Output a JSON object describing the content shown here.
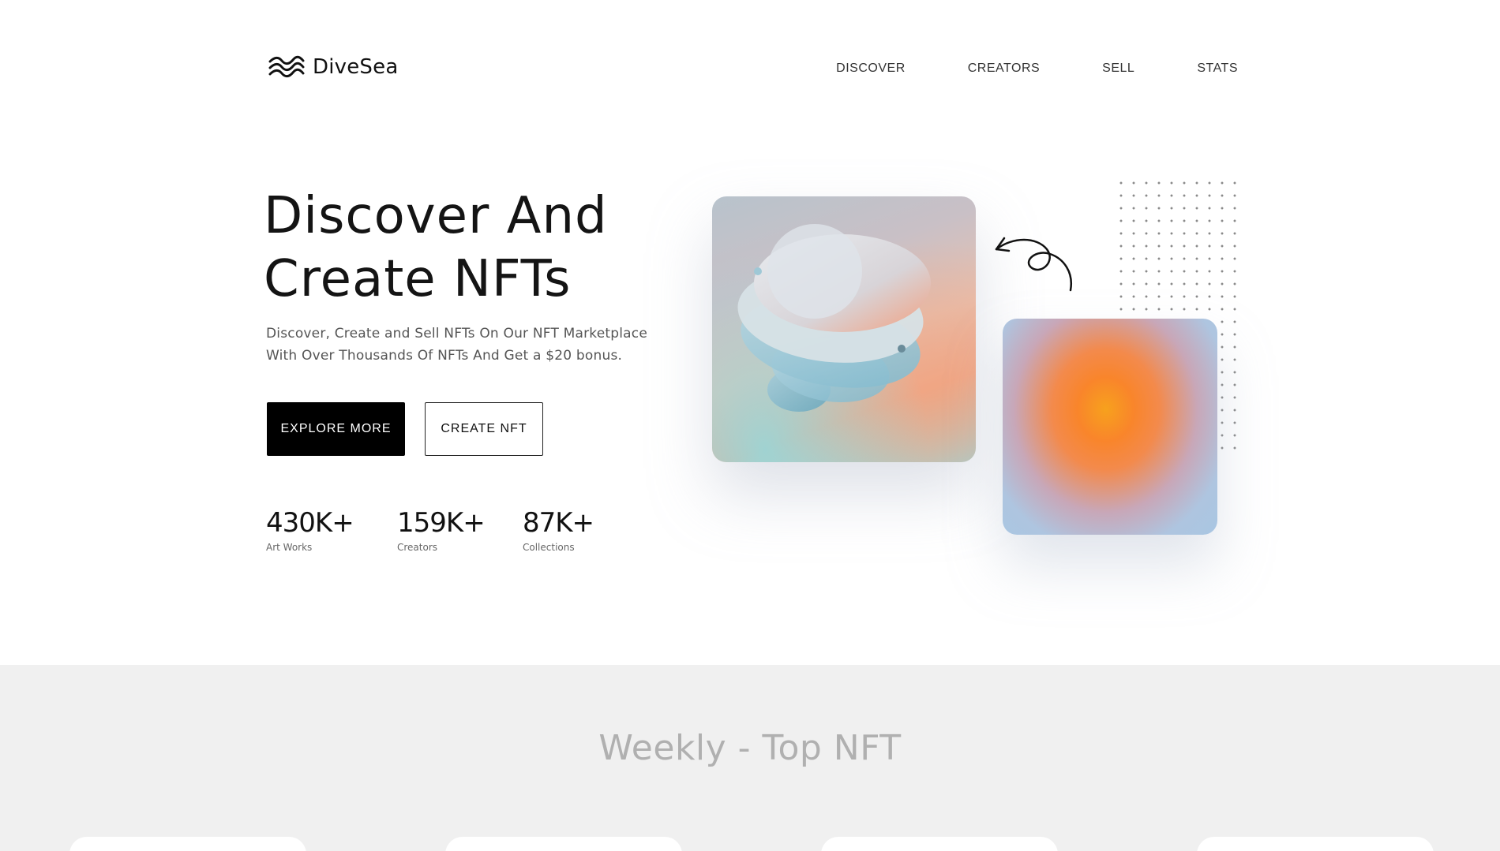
{
  "header": {
    "logo_text": "DiveSea",
    "nav": [
      {
        "label": "DISCOVER"
      },
      {
        "label": "CREATORS"
      },
      {
        "label": "SELL"
      },
      {
        "label": "STATS"
      }
    ]
  },
  "hero": {
    "title_line1": "Discover And",
    "title_line2": "Create NFTs",
    "subtitle_line1": "Discover, Create and Sell NFTs On Our NFT Marketplace",
    "subtitle_line2": "With Over Thousands Of NFTs And Get a $20 bonus.",
    "primary_button": "EXPLORE MORE",
    "secondary_button": "CREATE NFT",
    "stats": [
      {
        "value": "430K+",
        "label": "Art Works"
      },
      {
        "value": "159K+",
        "label": "Creators"
      },
      {
        "value": "87K+",
        "label": "Collections"
      }
    ]
  },
  "weekly": {
    "title": "Weekly - Top NFT"
  },
  "colors": {
    "primary": "#000000",
    "background": "#ffffff",
    "section_background": "#f0f0f0",
    "muted_title": "#b0b0b0"
  }
}
